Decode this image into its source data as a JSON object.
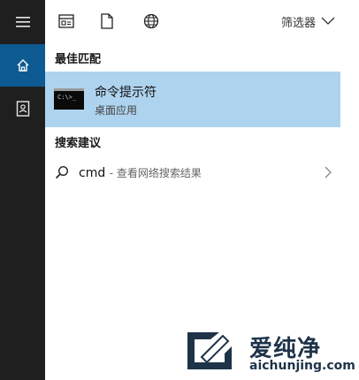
{
  "rail": {
    "items": [
      {
        "icon": "hamburger-menu-icon"
      },
      {
        "icon": "home-icon",
        "active": true
      },
      {
        "icon": "document-contact-icon"
      }
    ],
    "active_color": "#0e5a93",
    "bg_color": "#1f1f1f"
  },
  "toolbar": {
    "icons": [
      "apps-icon",
      "document-icon",
      "web-globe-icon"
    ],
    "filter_label": "筛选器"
  },
  "best_match": {
    "section_title": "最佳匹配",
    "title": "命令提示符",
    "subtitle": "桌面应用",
    "thumb_text": "C:\\>_",
    "highlight_color": "#aed3ee"
  },
  "suggestions": {
    "section_title": "搜索建议",
    "items": [
      {
        "term": "cmd",
        "hint": "- 查看网络搜索结果"
      }
    ]
  },
  "watermark": {
    "cn": "爱纯净",
    "url": "aichunjing.com"
  }
}
